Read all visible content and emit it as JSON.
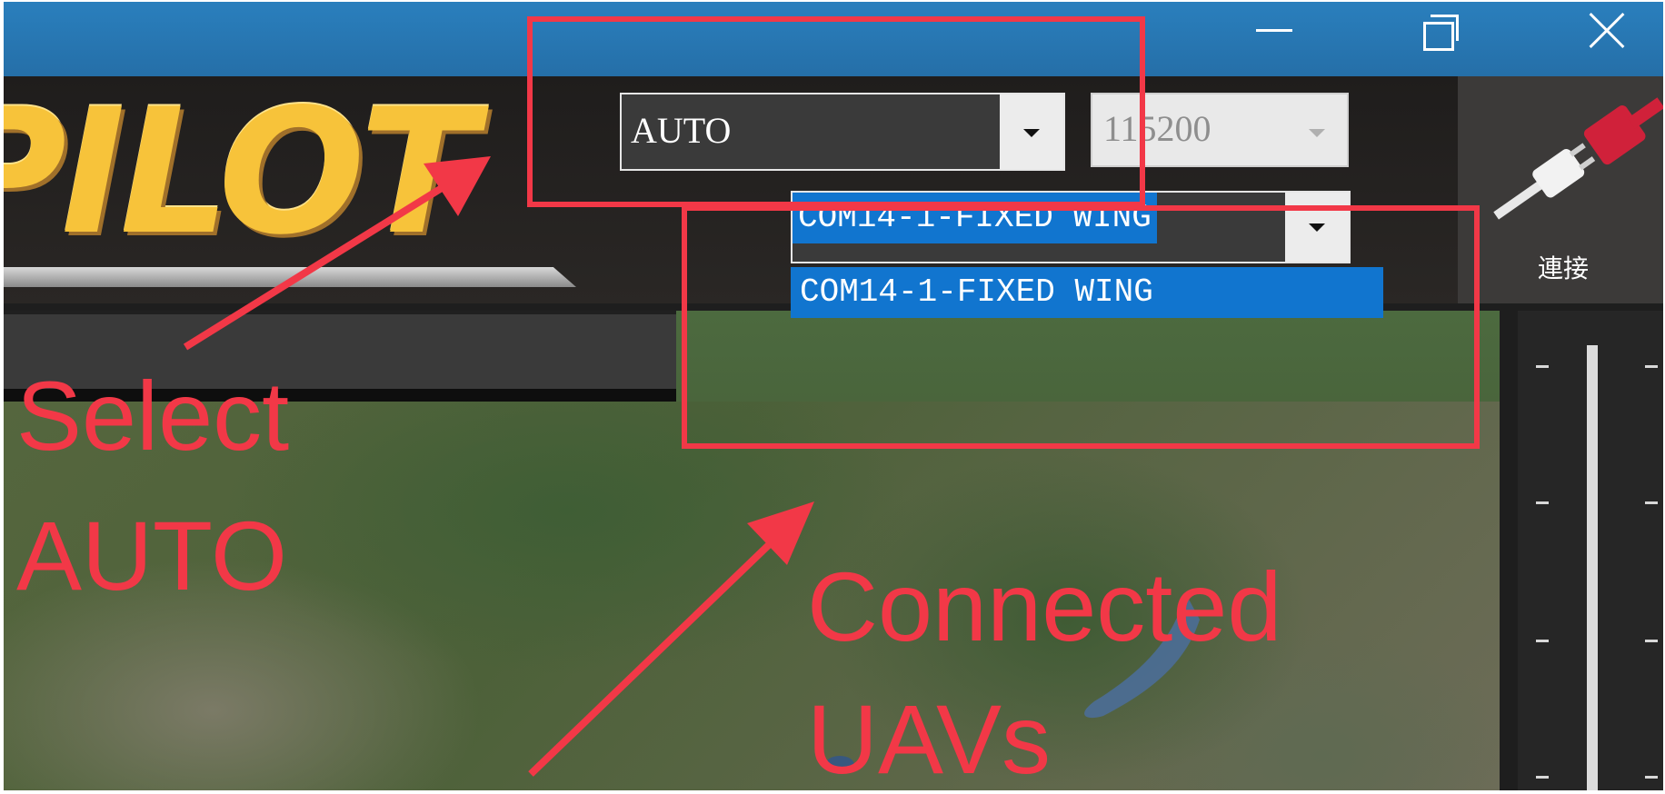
{
  "window": {
    "controls": {
      "minimize_icon": "minimize-icon",
      "maximize_icon": "restore-icon",
      "close_icon": "close-icon"
    }
  },
  "header": {
    "logo_text": "PILOT",
    "port_select": {
      "value": "AUTO"
    },
    "baud_select": {
      "value": "115200",
      "enabled": false
    },
    "uav_select": {
      "value": "COM14-1-FIXED WING",
      "options": [
        "COM14-1-FIXED WING"
      ]
    },
    "connect": {
      "label": "連接",
      "icon": "plug-connect-icon"
    }
  },
  "annotations": {
    "select_line1": "Select",
    "select_line2": "AUTO",
    "connected_line1": "Connected",
    "connected_line2": "UAVs",
    "color": "#f23847"
  },
  "colors": {
    "titlebar": "#2a7fbd",
    "selection": "#1175cf",
    "logo": "#f7c33a"
  }
}
